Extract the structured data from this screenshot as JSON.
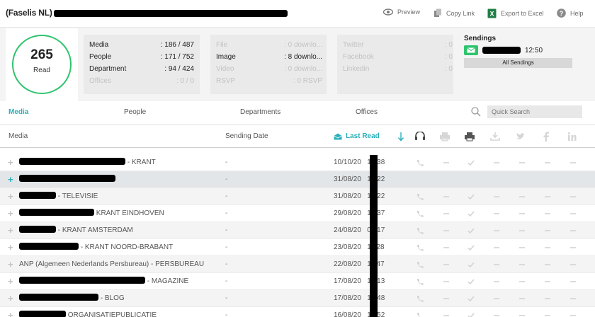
{
  "header": {
    "title": "(Faselis NL)",
    "preview": "Preview",
    "copy_link": "Copy Link",
    "export_excel": "Export to Excel",
    "help": "Help"
  },
  "summary": {
    "read_count": "265",
    "read_label": "Read",
    "accent_color": "#2fc46e",
    "stats": [
      {
        "label": "Media",
        "value": ": 186 / 487",
        "active": true
      },
      {
        "label": "People",
        "value": ": 171 / 752",
        "active": true
      },
      {
        "label": "Department",
        "value": ": 94 / 424",
        "active": true
      },
      {
        "label": "Offices",
        "value": ": 0 / 0",
        "active": false
      }
    ],
    "files": [
      {
        "label": "File",
        "value": ": 0 downlo...",
        "active": false
      },
      {
        "label": "Image",
        "value": ": 8 downlo...",
        "active": true
      },
      {
        "label": "Video",
        "value": ": 0 downlo...",
        "active": false
      },
      {
        "label": "RSVP",
        "value": ": 0 RSVP",
        "active": false
      }
    ],
    "social": [
      {
        "label": "Twitter",
        "value": ": 0"
      },
      {
        "label": "Facebook",
        "value": ": 0"
      },
      {
        "label": "Linkedin",
        "value": ": 0"
      }
    ],
    "sendings": {
      "title": "Sendings",
      "time": "12:50",
      "all_button": "All Sendings"
    }
  },
  "tabs": [
    "Media",
    "People",
    "Departments",
    "Offices"
  ],
  "search": {
    "placeholder": "Quick Search"
  },
  "columns": {
    "media": "Media",
    "sending_date": "Sending Date",
    "last_read": "Last Read"
  },
  "rows": [
    {
      "media": "KRANT",
      "date": "-",
      "last_read": "10/10/20",
      "time": "15:38"
    },
    {
      "media": "",
      "date": "-",
      "last_read": "31/08/20",
      "time": "16:22"
    },
    {
      "media": "TELEVISIE",
      "date": "-",
      "last_read": "31/08/20",
      "time": "16:22"
    },
    {
      "media": "KRANT EINDHOVEN",
      "date": "-",
      "last_read": "29/08/20",
      "time": "12:37"
    },
    {
      "media": "KRANT AMSTERDAM",
      "date": "-",
      "last_read": "24/08/20",
      "time": "09:17"
    },
    {
      "media": "- KRANT NOORD-BRABANT",
      "date": "-",
      "last_read": "23/08/20",
      "time": "11:28"
    },
    {
      "media": "ANP (Algemeen Nederlands Persbureau) - PERSBUREAU",
      "date": "-",
      "last_read": "22/08/20",
      "time": "11:47"
    },
    {
      "media": "MAGAZINE",
      "date": "-",
      "last_read": "17/08/20",
      "time": "15:13"
    },
    {
      "media": "BLOG",
      "date": "-",
      "last_read": "17/08/20",
      "time": "13:48"
    },
    {
      "media": "ORGANISATIEPUBLICATIE",
      "date": "-",
      "last_read": "16/08/20",
      "time": "12:52"
    }
  ]
}
